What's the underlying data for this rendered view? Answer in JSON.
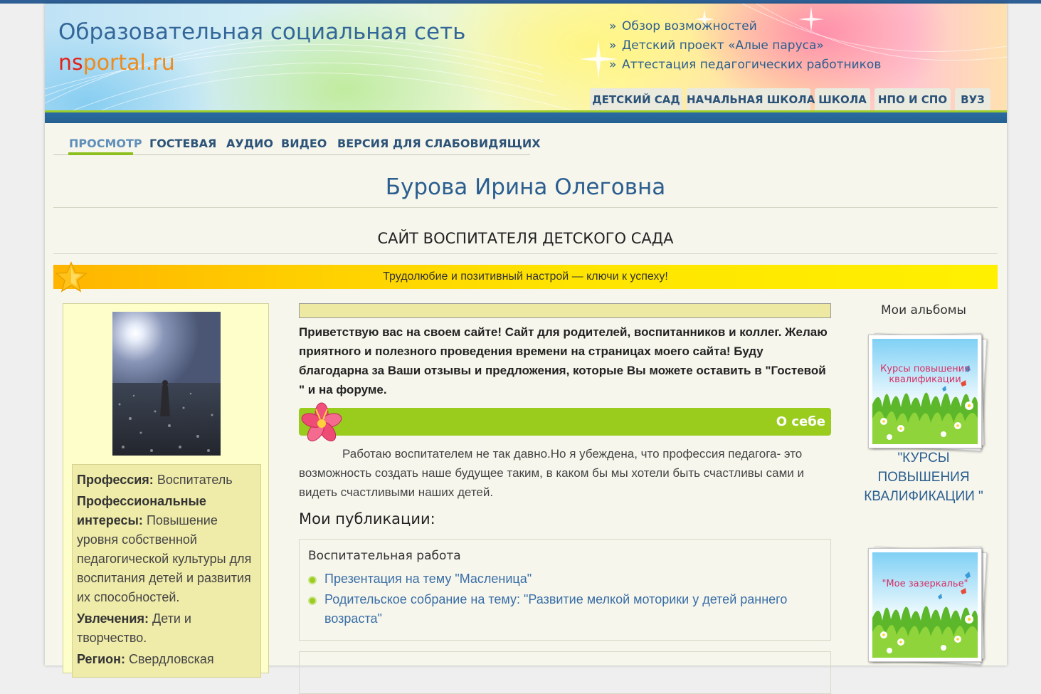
{
  "header": {
    "site_title": "Образовательная социальная сеть",
    "domain_part1": "ns",
    "domain_part2": "portal.ru",
    "top_links": [
      "Обзор возможностей",
      "Детский проект «Алые паруса»",
      "Аттестация педагогических работников"
    ],
    "tabs": [
      "ДЕТСКИЙ САД",
      "НАЧАЛЬНАЯ ШКОЛА",
      "ШКОЛА",
      "НПО И СПО",
      "ВУЗ"
    ]
  },
  "subnav": {
    "items": [
      "ПРОСМОТР",
      "ГОСТЕВАЯ",
      "АУДИО",
      "ВИДЕО",
      "ВЕРСИЯ ДЛЯ СЛАБОВИДЯЩИХ"
    ],
    "active": "ПРОСМОТР"
  },
  "person_name": "Бурова Ирина Олеговна",
  "site_caption": "САЙТ ВОСПИТАТЕЛЯ ДЕТСКОГО САДА",
  "motto": "Трудолюбие и позитивный настрой — ключи к успеху!",
  "profile": {
    "profession_label": "Профессия:",
    "profession_value": "Воспитатель",
    "interests_label": "Профессиональные интересы:",
    "interests_value": "Повышение уровня собственной педагогической культуры для воспитания детей и развития их способностей.",
    "hobbies_label": "Увлечения:",
    "hobbies_value": "Дети и творчество.",
    "region_label": "Регион:",
    "region_value": "Свердловская"
  },
  "welcome_text": "Приветствую вас на своем сайте! Сайт для родителей, воспитанников и коллег. Желаю приятного и полезного проведения времени на страницах моего сайта! Буду благодарна за Ваши отзывы и предложения, которые Вы можете оставить в \"Гостевой \" и на форуме.",
  "about": {
    "title": "О себе",
    "text": "Работаю воспитателем не так давно.Но я убеждена, что профессия педагога- это возможность создать наше будущее таким, в каком бы мы хотели быть счастливы сами и видеть счастливыми наших детей."
  },
  "publications": {
    "title": "Мои публикации:",
    "category": "Воспитательная работа",
    "items": [
      "Презентация на тему \"Масленица\"",
      "Родительское собрание на тему: \"Развитие мелкой моторики у детей раннего возраста\""
    ]
  },
  "albums": {
    "title": "Мои альбомы",
    "items": [
      {
        "thumb_text": "Курсы повышения квалификации",
        "caption": "\"КУРСЫ ПОВЫШЕНИЯ КВАЛИФИКАЦИИ \""
      },
      {
        "thumb_text": "\"Мое зазеркалье\"",
        "caption": ""
      }
    ]
  },
  "colors": {
    "link_blue": "#2b5e8f",
    "accent_green": "#99cc1d",
    "motto_yellow": "#ffe400",
    "domain_red": "#e32119",
    "domain_orange": "#f08a1c"
  }
}
